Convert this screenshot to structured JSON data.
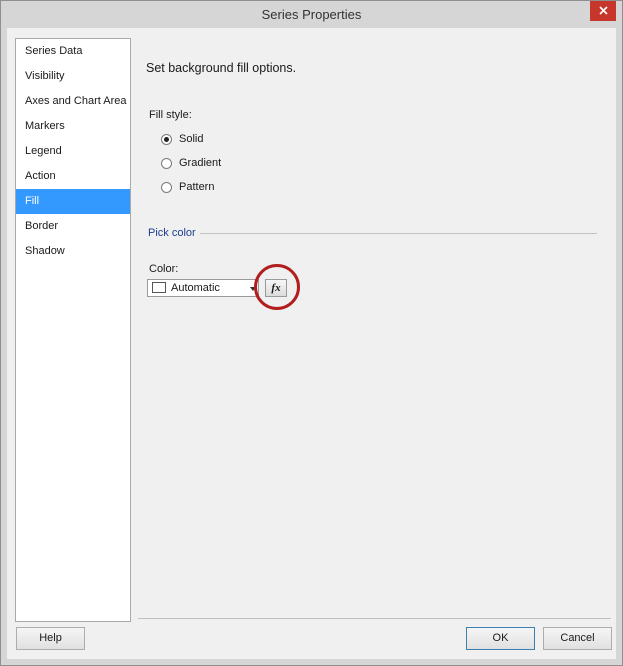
{
  "window": {
    "title": "Series Properties"
  },
  "sidebar": {
    "items": [
      {
        "label": "Series Data",
        "selected": false
      },
      {
        "label": "Visibility",
        "selected": false
      },
      {
        "label": "Axes and Chart Area",
        "selected": false
      },
      {
        "label": "Markers",
        "selected": false
      },
      {
        "label": "Legend",
        "selected": false
      },
      {
        "label": "Action",
        "selected": false
      },
      {
        "label": "Fill",
        "selected": true
      },
      {
        "label": "Border",
        "selected": false
      },
      {
        "label": "Shadow",
        "selected": false
      }
    ]
  },
  "main": {
    "heading": "Set background fill options.",
    "fill_style_label": "Fill style:",
    "fill_options": [
      {
        "label": "Solid",
        "checked": true
      },
      {
        "label": "Gradient",
        "checked": false
      },
      {
        "label": "Pattern",
        "checked": false
      }
    ],
    "pick_color_group": "Pick color",
    "color_label": "Color:",
    "color_value": "Automatic",
    "expression_button": "fx"
  },
  "footer": {
    "help_label": "Help",
    "ok_label": "OK",
    "cancel_label": "Cancel"
  },
  "colors": {
    "selection": "#3399ff",
    "group_label": "#1e3d91",
    "close_button": "#c7362b",
    "highlight_circle": "#b21d1d"
  }
}
